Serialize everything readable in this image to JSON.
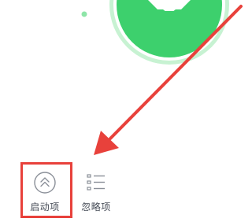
{
  "colors": {
    "accent_green": "#3dd06d",
    "ring_green": "#8ee5a8",
    "annotation_red": "#e8413b",
    "icon_gray": "#8a8f98"
  },
  "badge": {
    "icon": "shield-face-icon"
  },
  "tabs": [
    {
      "label": "启动项",
      "icon": "double-chevron-up-circle-icon",
      "highlighted": true
    },
    {
      "label": "忽略项",
      "icon": "list-icon",
      "highlighted": false
    }
  ],
  "annotation": {
    "type": "arrow",
    "target": "tab-startup"
  }
}
